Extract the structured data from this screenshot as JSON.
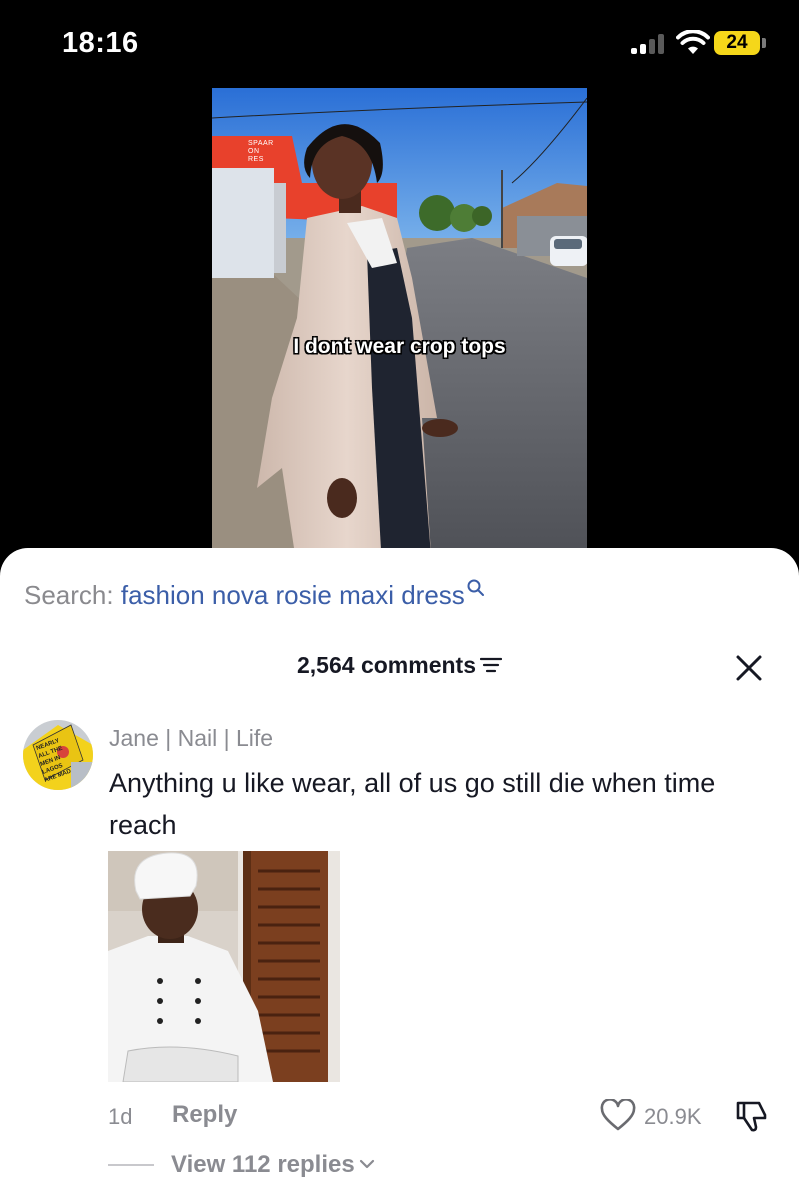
{
  "status_bar": {
    "time": "18:16",
    "battery": "24"
  },
  "video": {
    "caption": "I dont wear crop tops",
    "sign_text": "SPAAR\nON\nRES"
  },
  "search": {
    "label": "Search:",
    "query": "fashion nova rosie maxi dress"
  },
  "comments_header": {
    "count_label": "2,564 comments"
  },
  "comment": {
    "author": "Jane | Nail | Life",
    "text": "Anything u like wear, all of us go still die when time reach",
    "avatar_text": "NEARLY ALL THE MEN IN LAGOS ARE MAD",
    "age": "1d",
    "reply_label": "Reply",
    "likes": "20.9K",
    "view_replies": "View 112 replies"
  },
  "colors": {
    "battery": "#f5d71a",
    "link": "#3b5ea8",
    "muted": "#8a8b91"
  }
}
